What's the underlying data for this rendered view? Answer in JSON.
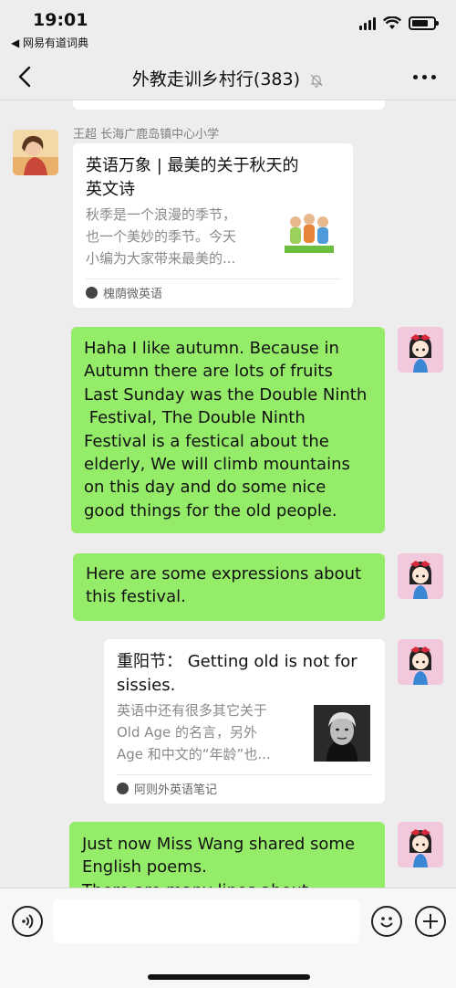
{
  "status": {
    "time": "19:01",
    "back_app": "◀ 网易有道词典"
  },
  "nav": {
    "title": "外教走训乡村行(383)"
  },
  "messages": {
    "sender_name": "王超 长海广鹿岛镇中心小学",
    "card1": {
      "title_lines": [
        "英语万象 | 最美的关于秋天的",
        "英文诗"
      ],
      "desc_lines": [
        "秋季是一个浪漫的季节，",
        "也一个美妙的季节。今天",
        "小编为大家带来最美的..."
      ],
      "source": "槐荫微英语"
    },
    "bubble1": {
      "lines": [
        "Haha I like autumn. Because in",
        "Autumn there are lots of fruits",
        "Last Sunday was the Double Ninth",
        " Festival, The Double Ninth",
        "Festival is a festical about the",
        "elderly, We will climb mountains",
        "on this day and do some nice",
        "good things for the old people."
      ]
    },
    "bubble2": {
      "lines": [
        "Here are some expressions about",
        "this festival."
      ]
    },
    "card2": {
      "title_lines": [
        "重阳节：  Getting old is not for",
        "sissies."
      ],
      "desc_lines": [
        "英语中还有很多其它关于",
        "Old Age 的名言，另外",
        "Age 和中文的“年龄”也..."
      ],
      "source": "阿则外英语笔记"
    },
    "bubble3": {
      "lines": [
        "Just now Miss Wang shared some",
        "English poems.",
        "There are many lines about"
      ]
    }
  },
  "colors": {
    "bubble_green": "#95ec69",
    "background": "#ededed",
    "card_white": "#ffffff"
  },
  "icons": {
    "nav_back": "chevron-left-icon",
    "mute": "bell-off-icon",
    "more": "more-dots-icon",
    "voice": "voice-icon",
    "emoji": "emoji-icon",
    "plus": "plus-icon"
  }
}
